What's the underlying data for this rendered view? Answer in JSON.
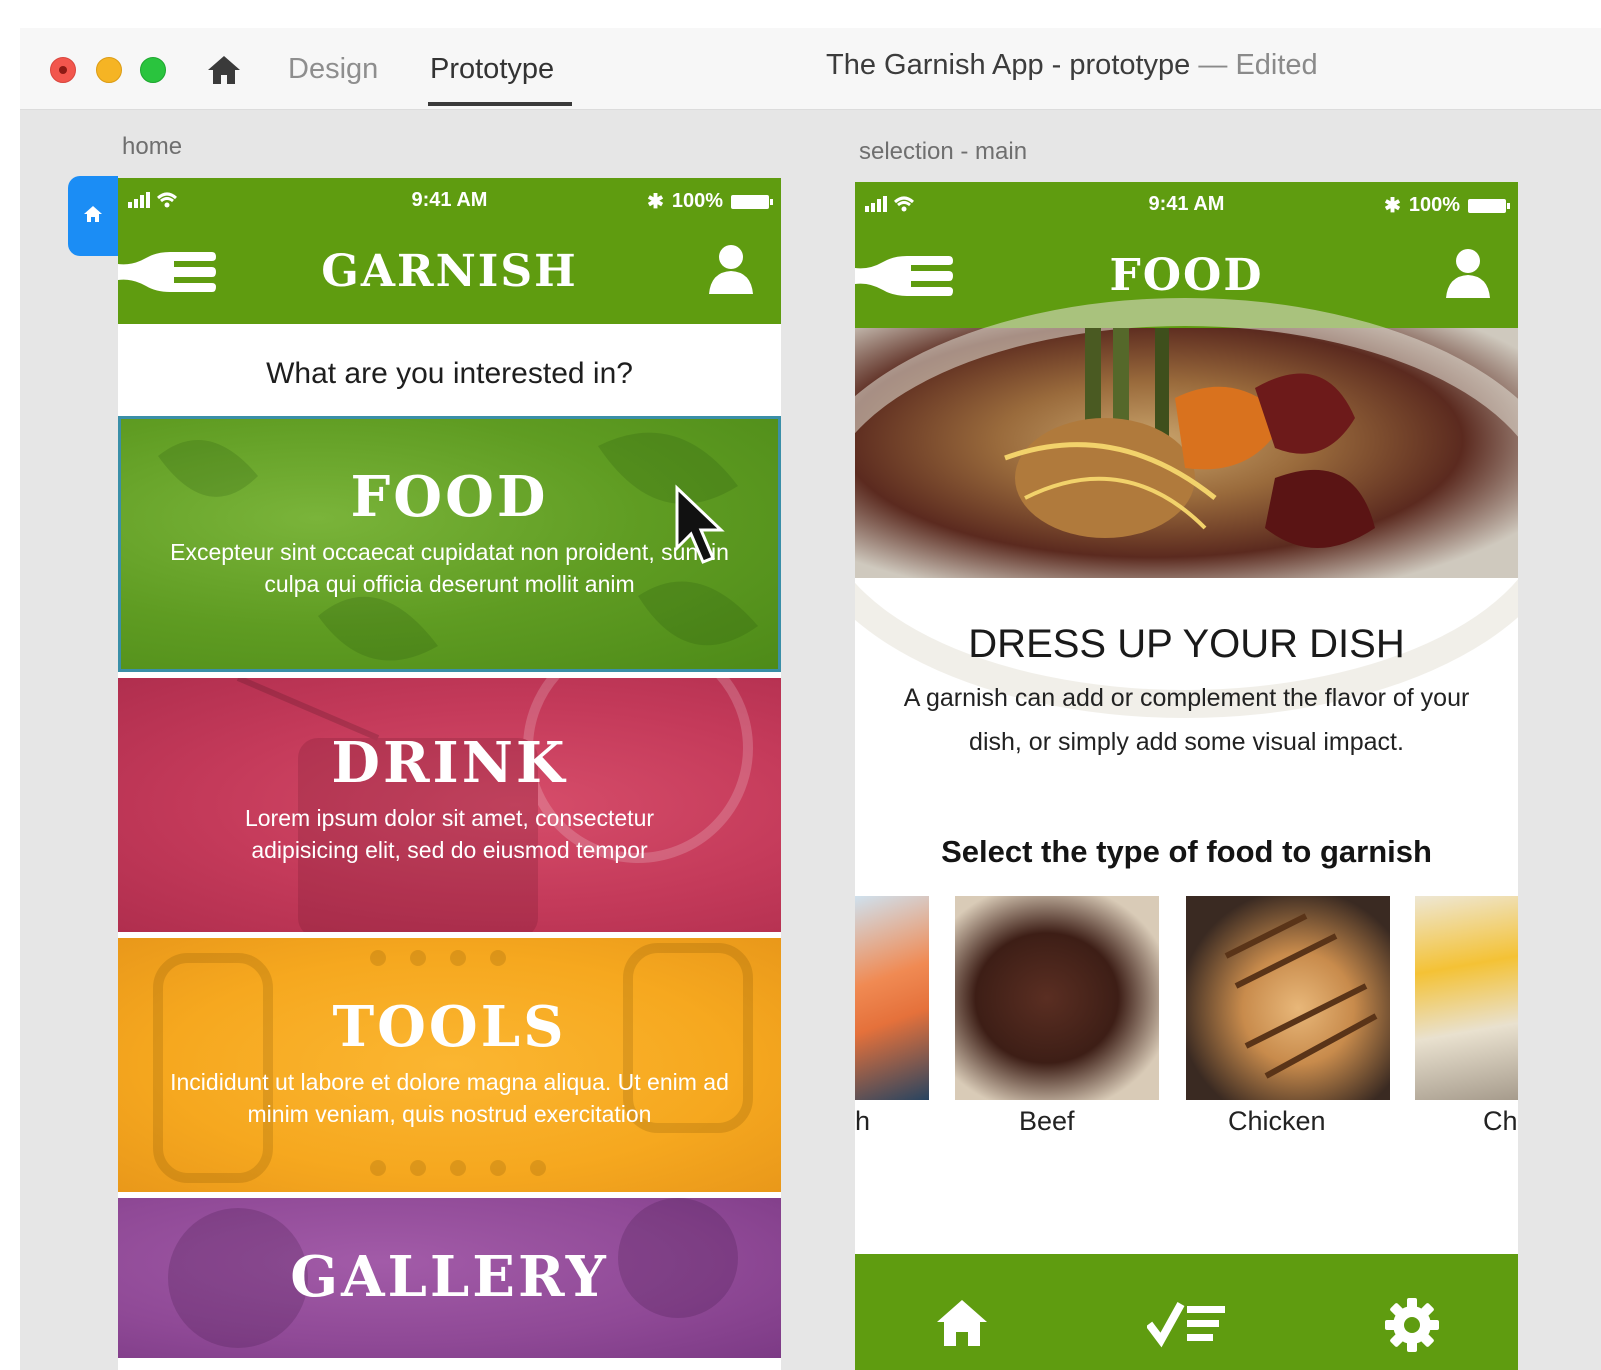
{
  "window": {
    "tabs": [
      {
        "label": "Design"
      },
      {
        "label": "Prototype",
        "active": true
      }
    ],
    "doc_title": "The Garnish App - prototype",
    "doc_separator": "—",
    "doc_status": "Edited"
  },
  "home_artboard": {
    "label": "home",
    "status": {
      "time": "9:41 AM",
      "battery": "100%"
    },
    "nav_title": "GARNISH",
    "question": "What are you interested in?",
    "tiles": [
      {
        "title": "FOOD",
        "desc": "Excepteur sint occaecat cupidatat non proident, sunt in culpa qui officia deserunt mollit anim",
        "color": "#5f9c22"
      },
      {
        "title": "DRINK",
        "desc": "Lorem ipsum dolor sit amet, consectetur adipisicing elit, sed do eiusmod tempor",
        "color": "#c43a5a"
      },
      {
        "title": "TOOLS",
        "desc": "Incididunt ut labore et dolore magna aliqua. Ut enim ad minim veniam, quis nostrud exercitation",
        "color": "#f6a81f"
      },
      {
        "title": "GALLERY",
        "desc": "",
        "color": "#8f4996"
      }
    ]
  },
  "selection_artboard": {
    "label": "selection - main",
    "status": {
      "time": "9:41 AM",
      "battery": "100%"
    },
    "nav_title": "FOOD",
    "heading": "DRESS UP YOUR DISH",
    "description": "A garnish can add or complement the flavor of your dish, or simply add some visual impact.",
    "select_heading": "Select the type of food to garnish",
    "food_types": [
      "Fish",
      "Beef",
      "Chicken",
      "Cheese"
    ],
    "visible_labels": [
      "h",
      "Beef",
      "Chicken",
      "Ch"
    ],
    "bottom_nav": [
      "home-icon",
      "checklist-icon",
      "gear-icon"
    ]
  },
  "colors": {
    "brand_green": "#5f9c10",
    "prototype_flag": "#1b8df5"
  }
}
